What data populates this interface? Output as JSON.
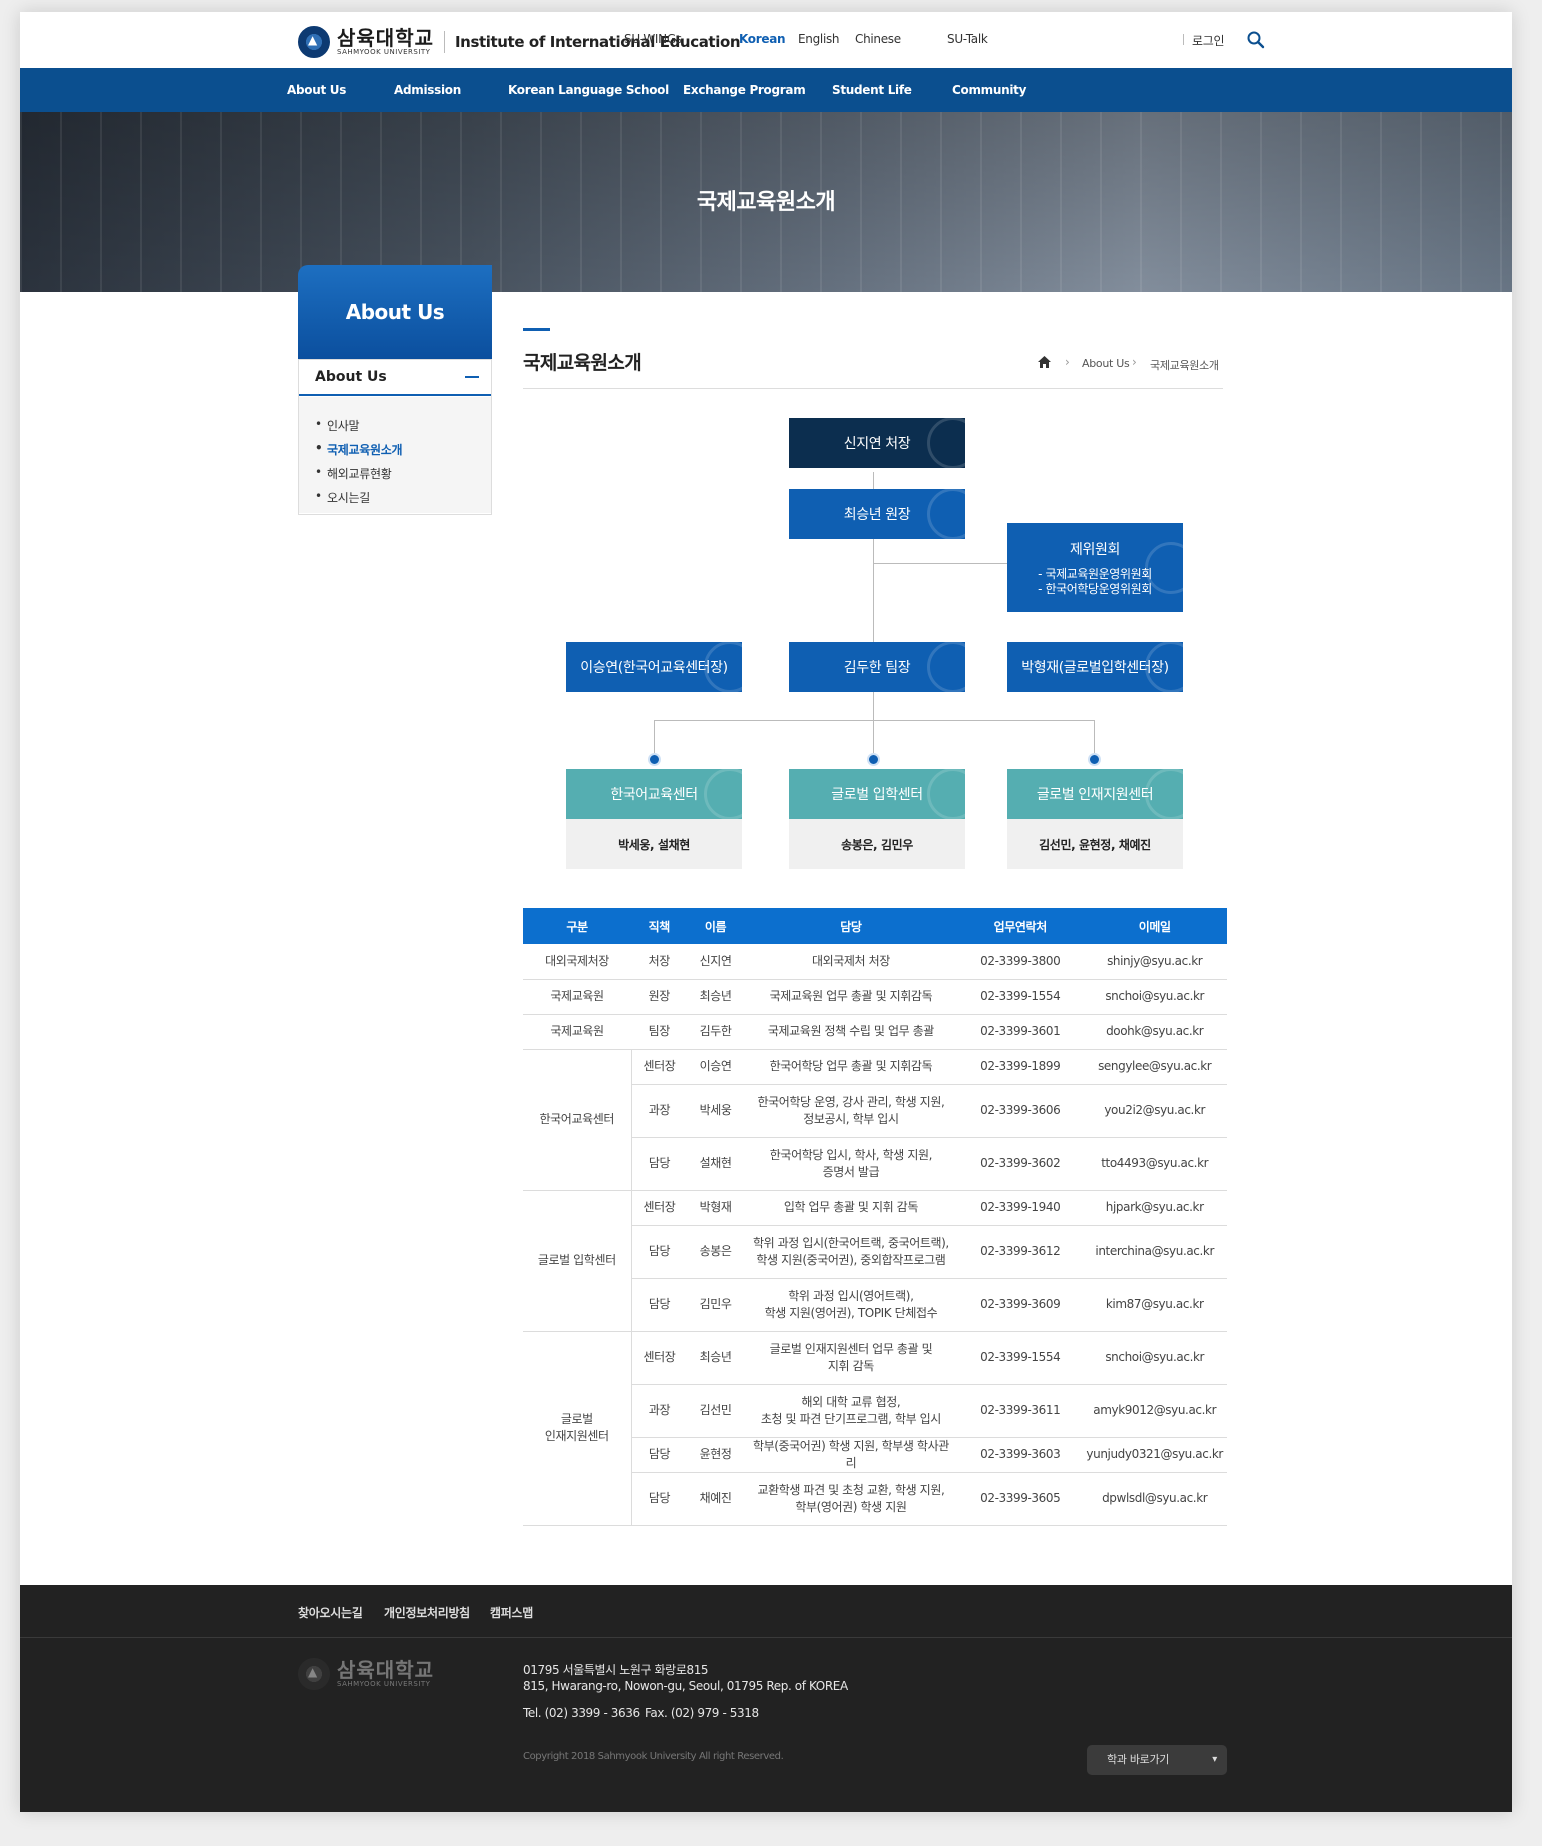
{
  "header": {
    "logo_ko": "삼육대학교",
    "logo_en": "SAHMYOOK UNIVERSITY",
    "institute": "Institute of International Education",
    "suwings": "SU-WINGs",
    "lang_korean": "Korean",
    "lang_english": "English",
    "lang_chinese": "Chinese",
    "sutalk": "SU-Talk",
    "login": "로그인"
  },
  "gnb": [
    "About Us",
    "Admission",
    "Korean Language School",
    "Exchange Program",
    "Student Life",
    "Community"
  ],
  "visual_title": "국제교육원소개",
  "lnb": {
    "head": "About Us",
    "category": "About Us",
    "items": [
      "인사말",
      "국제교육원소개",
      "해외교류현황",
      "오시는길"
    ]
  },
  "content": {
    "title": "국제교육원소개",
    "breadcrumb": [
      "About Us",
      "국제교육원소개"
    ]
  },
  "org": {
    "director": "신지연 처장",
    "dean": "최승년 원장",
    "committee_title": "제위원회",
    "committee_items": [
      "- 국제교육원운영위원회",
      "- 한국어학당운영위원회"
    ],
    "left_lead": "이승연(한국어교육센터장)",
    "team_lead": "김두한 팀장",
    "right_lead": "박형재(글로벌입학센터장)",
    "centers": [
      {
        "name": "한국어교육센터",
        "members": "박세웅, 설채현"
      },
      {
        "name": "글로벌 입학센터",
        "members": "송봉은, 김민우"
      },
      {
        "name": "글로벌 인재지원센터",
        "members": "김선민, 윤현정, 채예진"
      }
    ]
  },
  "table": {
    "headers": [
      "구분",
      "직책",
      "이름",
      "담당",
      "업무연락처",
      "이메일"
    ],
    "rows": [
      {
        "group": "대외국제처장",
        "pos": "처장",
        "name": "신지연",
        "duty": "대외국제처 처장",
        "tel": "02-3399-3800",
        "email": "shinjy@syu.ac.kr"
      },
      {
        "group": "국제교육원",
        "pos": "원장",
        "name": "최승년",
        "duty": "국제교육원 업무 총괄 및 지휘감독",
        "tel": "02-3399-1554",
        "email": "snchoi@syu.ac.kr"
      },
      {
        "group": "국제교육원",
        "pos": "팀장",
        "name": "김두한",
        "duty": "국제교육원 정책 수립 및 업무 총괄",
        "tel": "02-3399-3601",
        "email": "doohk@syu.ac.kr"
      },
      {
        "group": "한국어교육센터",
        "pos": "센터장",
        "name": "이승연",
        "duty": "한국어학당 업무 총괄 및 지휘감독",
        "tel": "02-3399-1899",
        "email": "sengylee@syu.ac.kr"
      },
      {
        "pos": "과장",
        "name": "박세웅",
        "duty1": "한국어학당 운영, 강사 관리, 학생 지원,",
        "duty2": "정보공시, 학부 입시",
        "tel": "02-3399-3606",
        "email": "you2i2@syu.ac.kr"
      },
      {
        "pos": "담당",
        "name": "설채현",
        "duty1": "한국어학당 입시, 학사, 학생 지원,",
        "duty2": "증명서 발급",
        "tel": "02-3399-3602",
        "email": "tto4493@syu.ac.kr"
      },
      {
        "group": "글로벌 입학센터",
        "pos": "센터장",
        "name": "박형재",
        "duty": "입학 업무 총괄 및 지휘 감독",
        "tel": "02-3399-1940",
        "email": "hjpark@syu.ac.kr"
      },
      {
        "pos": "담당",
        "name": "송봉은",
        "duty1": "학위 과정 입시(한국어트랙, 중국어트랙),",
        "duty2": "학생 지원(중국어권), 중외합작프로그램",
        "tel": "02-3399-3612",
        "email": "interchina@syu.ac.kr"
      },
      {
        "pos": "담당",
        "name": "김민우",
        "duty1": "학위 과정 입시(영어트랙),",
        "duty2": "학생 지원(영어권), TOPIK 단체접수",
        "tel": "02-3399-3609",
        "email": "kim87@syu.ac.kr"
      },
      {
        "group1": "글로벌",
        "group2": "인재지원센터",
        "pos": "센터장",
        "name": "최승년",
        "duty1": "글로벌 인재지원센터 업무 총괄 및",
        "duty2": "지휘 감독",
        "tel": "02-3399-1554",
        "email": "snchoi@syu.ac.kr"
      },
      {
        "pos": "과장",
        "name": "김선민",
        "duty1": "해외 대학 교류 협정,",
        "duty2": "초청 및 파견 단기프로그램, 학부 입시",
        "tel": "02-3399-3611",
        "email": "amyk9012@syu.ac.kr"
      },
      {
        "pos": "담당",
        "name": "윤현정",
        "duty": "학부(중국어권) 학생 지원, 학부생 학사관리",
        "tel": "02-3399-3603",
        "email": "yunjudy0321@syu.ac.kr"
      },
      {
        "pos": "담당",
        "name": "채예진",
        "duty1": "교환학생 파견 및 초청 교환, 학생 지원,",
        "duty2": "학부(영어권) 학생 지원",
        "tel": "02-3399-3605",
        "email": "dpwlsdl@syu.ac.kr"
      }
    ]
  },
  "footer": {
    "links": [
      "찾아오시는길",
      "개인정보처리방침",
      "캠퍼스맵"
    ],
    "address_ko": "01795 서울특별시 노원구 화랑로815",
    "address_en": "815, Hwarang-ro, Nowon-gu, Seoul, 01795 Rep. of KOREA",
    "tel": "Tel. (02) 3399 - 3636",
    "fax": "Fax. (02) 979 - 5318",
    "copyright": "Copyright 2018 Sahmyook University All right Reserved.",
    "select_label": "학과 바로가기"
  },
  "colors": {
    "primary": "#0b4f8f",
    "accent": "#0f5fb2",
    "teal": "#55aeb1",
    "footer": "#222222"
  }
}
